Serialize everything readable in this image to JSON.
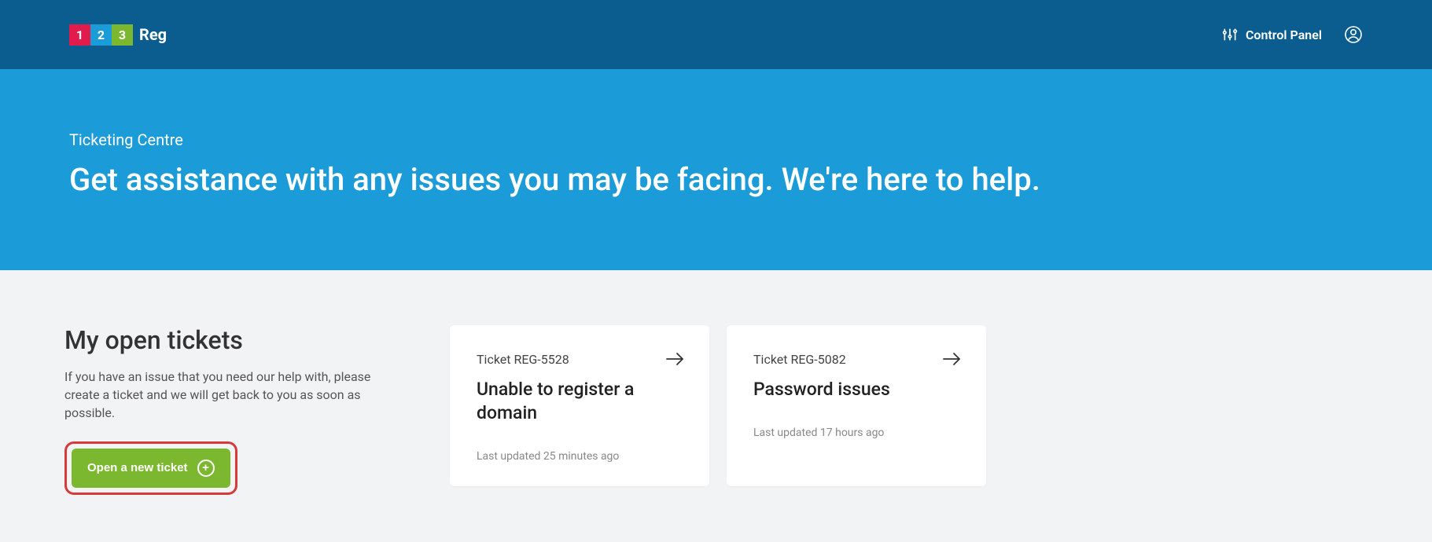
{
  "header": {
    "logo": {
      "n1": "1",
      "n2": "2",
      "n3": "3",
      "text": "Reg"
    },
    "control_panel_label": "Control Panel"
  },
  "hero": {
    "subtitle": "Ticketing Centre",
    "title": "Get assistance with any issues you may be facing. We're here to help."
  },
  "main": {
    "section_title": "My open tickets",
    "section_desc": "If you have an issue that you need our help with, please create a ticket and we will get back to you as soon as possible.",
    "open_ticket_label": "Open a new ticket"
  },
  "tickets": [
    {
      "id": "Ticket REG-5528",
      "title": "Unable to register a domain",
      "updated": "Last updated 25 minutes ago"
    },
    {
      "id": "Ticket REG-5082",
      "title": "Password issues",
      "updated": "Last updated 17 hours ago"
    }
  ]
}
